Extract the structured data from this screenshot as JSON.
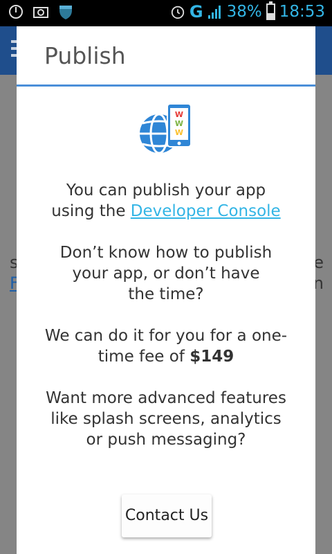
{
  "status_bar": {
    "network": "G",
    "battery_percent": "38%",
    "battery_level": 0.38,
    "time": "18:53",
    "icons": [
      "power-icon",
      "camera-icon",
      "shield-icon",
      "alarm-icon",
      "signal-icon",
      "battery-icon"
    ]
  },
  "background": {
    "left_fragment_1": "s",
    "left_fragment_2": "F",
    "right_fragment_1": "e",
    "right_fragment_2": "n"
  },
  "dialog": {
    "title": "Publish",
    "icon": "globe-phone-www-icon",
    "paragraph1_prefix": "You can publish your app using the ",
    "paragraph1_link": "Developer Console",
    "paragraph2": "Don’t know how to publish your app, or don’t have the time?",
    "paragraph3_prefix": "We can do it for you for a one-time fee of ",
    "paragraph3_price": "$149",
    "paragraph4": "Want more advanced features like splash screens, analytics or push messaging?",
    "contact_button": "Contact Us"
  },
  "colors": {
    "accent": "#33b5e5",
    "divider": "#4a8fd9",
    "www_red": "#e53935",
    "www_green": "#7cb342",
    "www_yellow": "#fbc02d"
  }
}
